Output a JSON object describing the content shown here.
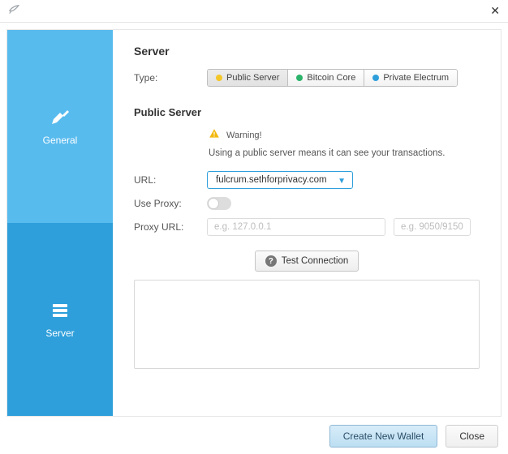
{
  "titlebar": {
    "close_glyph": "✕"
  },
  "sidebar": {
    "general_label": "General",
    "server_label": "Server"
  },
  "server": {
    "heading": "Server",
    "type_label": "Type:",
    "options": {
      "public": "Public Server",
      "core": "Bitcoin Core",
      "private": "Private Electrum"
    }
  },
  "public_server": {
    "heading": "Public Server",
    "warning_label": "Warning!",
    "warning_message": "Using a public server means it can see your transactions.",
    "url_label": "URL:",
    "url_value": "fulcrum.sethforprivacy.com",
    "use_proxy_label": "Use Proxy:",
    "proxy_url_label": "Proxy URL:",
    "proxy_host_placeholder": "e.g. 127.0.0.1",
    "proxy_port_placeholder": "e.g. 9050/9150",
    "test_connection_label": "Test Connection"
  },
  "footer": {
    "create_wallet_label": "Create New Wallet",
    "close_label": "Close"
  }
}
